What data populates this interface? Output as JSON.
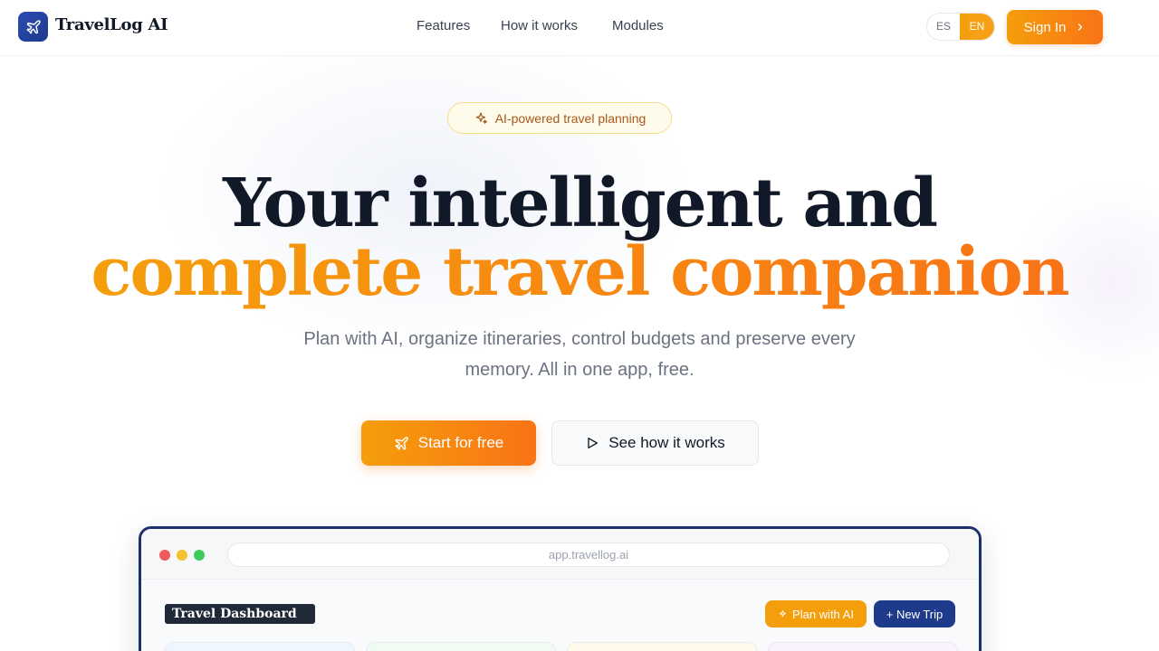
{
  "header": {
    "brand": "TravelLog AI",
    "nav": [
      "Features",
      "How it works",
      "Modules"
    ],
    "lang": {
      "es": "ES",
      "en": "EN",
      "active": "EN"
    },
    "signin": "Sign In"
  },
  "hero": {
    "badge": "AI-powered travel planning",
    "headline_line1": "Your intelligent and",
    "headline_line2": "complete travel companion",
    "subtitle_line1": "Plan with AI, organize itineraries, control budgets and preserve every",
    "subtitle_line2": "memory. All in one app, free.",
    "cta_primary": "Start for free",
    "cta_secondary": "See how it works"
  },
  "preview": {
    "url": "app.travellog.ai",
    "dashboard_title": "Travel Dashboard",
    "plan_ai": "Plan with AI",
    "new_trip": "+ New Trip"
  },
  "colors": {
    "accent_orange": "#f59e0b",
    "accent_deep_orange": "#f97316",
    "brand_navy": "#1e3a8a",
    "text_dark": "#111827",
    "text_muted": "#6b7280"
  }
}
